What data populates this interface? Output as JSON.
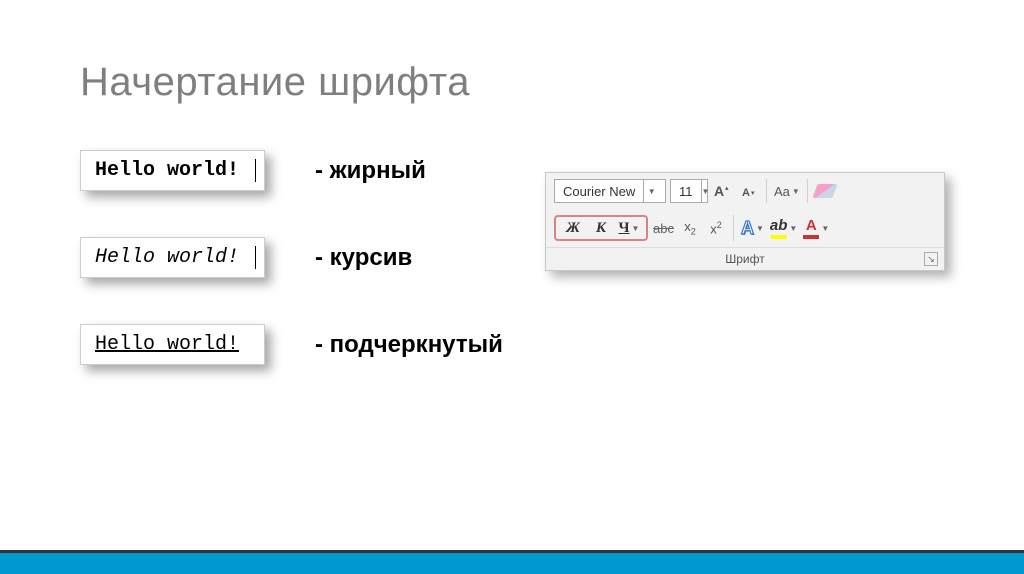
{
  "title": "Начертание шрифта",
  "examples": [
    {
      "text": "Hello world!",
      "label": "- жирный"
    },
    {
      "text": "Hello world!",
      "label": "- курсив"
    },
    {
      "text": "Hello world!",
      "label": "- подчеркнутый"
    }
  ],
  "ribbon": {
    "font_name": "Courier New",
    "font_size": "11",
    "group_label": "Шрифт",
    "bold_char": "Ж",
    "italic_char": "К",
    "underline_char": "Ч",
    "strike_text": "abc",
    "subscript": "x",
    "subscript_sub": "2",
    "superscript": "x",
    "superscript_sup": "2",
    "case_label": "Aa",
    "texteffect": "A",
    "highlight": "ab",
    "fontcolor": "A"
  }
}
